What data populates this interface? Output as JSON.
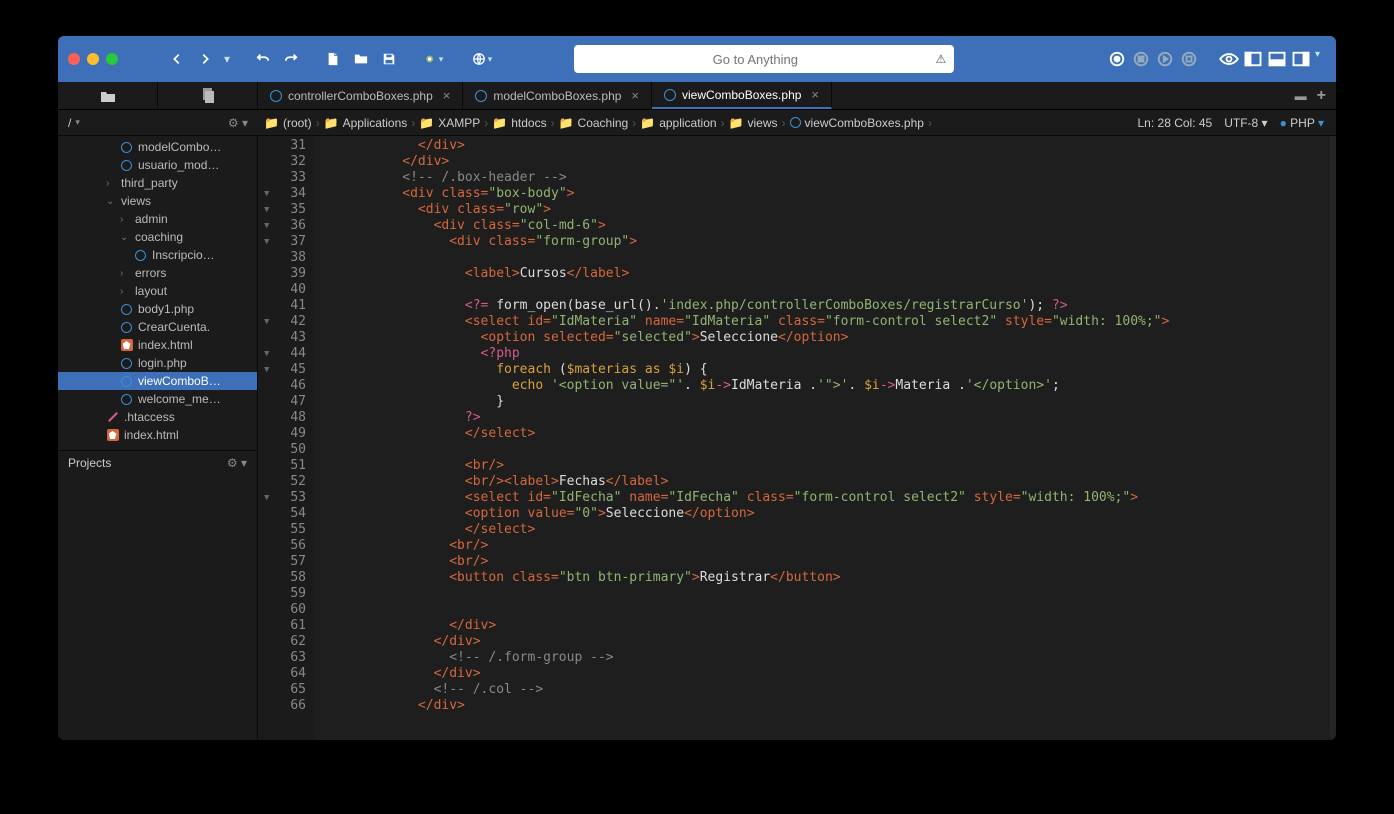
{
  "search": {
    "placeholder": "Go to Anything"
  },
  "tabs": [
    {
      "label": "controllerComboBoxes.php"
    },
    {
      "label": "modelComboBoxes.php"
    },
    {
      "label": "viewComboBoxes.php",
      "active": true
    }
  ],
  "sidebarRoot": "/",
  "breadcrumbs": [
    "(root)",
    "Applications",
    "XAMPP",
    "htdocs",
    "Coaching",
    "application",
    "views",
    "viewComboBoxes.php"
  ],
  "status": {
    "pos": "Ln: 28 Col: 45",
    "enc": "UTF-8",
    "lang": "PHP"
  },
  "tree": [
    {
      "d": 3,
      "ic": "ring",
      "label": "modelCombo…"
    },
    {
      "d": 3,
      "ic": "ring",
      "label": "usuario_mod…"
    },
    {
      "d": 2,
      "exp": "›",
      "label": "third_party"
    },
    {
      "d": 2,
      "exp": "⌄",
      "label": "views"
    },
    {
      "d": 3,
      "exp": "›",
      "label": "admin"
    },
    {
      "d": 3,
      "exp": "⌄",
      "label": "coaching"
    },
    {
      "d": 4,
      "ic": "ring",
      "label": "Inscripcio…"
    },
    {
      "d": 3,
      "exp": "›",
      "label": "errors"
    },
    {
      "d": 3,
      "exp": "›",
      "label": "layout"
    },
    {
      "d": 3,
      "ic": "ring",
      "label": "body1.php"
    },
    {
      "d": 3,
      "ic": "ring",
      "label": "CrearCuenta."
    },
    {
      "d": 3,
      "ic": "html",
      "label": "index.html"
    },
    {
      "d": 3,
      "ic": "ring",
      "label": "login.php"
    },
    {
      "d": 3,
      "ic": "ring",
      "label": "viewComboB…",
      "sel": true
    },
    {
      "d": 3,
      "ic": "ring",
      "label": "welcome_me…"
    },
    {
      "d": 2,
      "ic": "pen",
      "label": ".htaccess"
    },
    {
      "d": 2,
      "ic": "html",
      "label": "index.html"
    }
  ],
  "projectsLabel": "Projects",
  "gutter": {
    "start": 31,
    "end": 66,
    "folds": [
      34,
      35,
      36,
      37,
      42,
      44,
      45,
      53
    ]
  },
  "code": [
    {
      "n": 31,
      "i": 6,
      "h": "<span class='t-tag'>&lt;/div&gt;</span>"
    },
    {
      "n": 32,
      "i": 5,
      "h": "<span class='t-tag'>&lt;/div&gt;</span>"
    },
    {
      "n": 33,
      "i": 5,
      "h": "<span class='t-cm'>&lt;!-- /.box-header --&gt;</span>"
    },
    {
      "n": 34,
      "i": 5,
      "h": "<span class='t-tag'>&lt;div</span> <span class='t-attr'>class=</span><span class='t-str'>\"box-body\"</span><span class='t-tag'>&gt;</span>"
    },
    {
      "n": 35,
      "i": 6,
      "h": "<span class='t-tag'>&lt;div</span> <span class='t-attr'>class=</span><span class='t-str'>\"row\"</span><span class='t-tag'>&gt;</span>"
    },
    {
      "n": 36,
      "i": 7,
      "h": "<span class='t-tag'>&lt;div</span> <span class='t-attr'>class=</span><span class='t-str'>\"col-md-6\"</span><span class='t-tag'>&gt;</span>"
    },
    {
      "n": 37,
      "i": 8,
      "h": "<span class='t-tag'>&lt;div</span> <span class='t-attr'>class=</span><span class='t-str'>\"form-group\"</span><span class='t-tag'>&gt;</span>"
    },
    {
      "n": 38,
      "i": 0,
      "h": ""
    },
    {
      "n": 39,
      "i": 9,
      "h": "<span class='t-tag'>&lt;label&gt;</span><span class='t-txt'>Cursos</span><span class='t-tag'>&lt;/label&gt;</span>"
    },
    {
      "n": 40,
      "i": 0,
      "h": ""
    },
    {
      "n": 41,
      "i": 9,
      "h": "<span class='t-php'>&lt;?=</span> <span class='t-txt'>form_open(base_url().</span><span class='t-str'>'index.php/controllerComboBoxes/registrarCurso'</span><span class='t-txt'>); </span><span class='t-php'>?&gt;</span>"
    },
    {
      "n": 42,
      "i": 9,
      "h": "<span class='t-tag'>&lt;select</span> <span class='t-attr'>id=</span><span class='t-str'>\"IdMateria\"</span> <span class='t-attr'>name=</span><span class='t-str'>\"IdMateria\"</span> <span class='t-attr'>class=</span><span class='t-str'>\"form-control select2\"</span> <span class='t-attr'>style=</span><span class='t-str'>\"width: 100%;\"</span><span class='t-tag'>&gt;</span>"
    },
    {
      "n": 43,
      "i": 10,
      "h": "<span class='t-tag'>&lt;option</span> <span class='t-attr'>selected=</span><span class='t-str'>\"selected\"</span><span class='t-tag'>&gt;</span><span class='t-txt'>Seleccione</span><span class='t-tag'>&lt;/option&gt;</span>"
    },
    {
      "n": 44,
      "i": 10,
      "h": "<span class='t-php'>&lt;?php</span>"
    },
    {
      "n": 45,
      "i": 11,
      "h": "<span class='t-kw'>foreach</span> <span class='t-txt'>(</span><span class='t-var'>$materias</span> <span class='t-kw'>as</span> <span class='t-var'>$i</span><span class='t-txt'>) {</span>"
    },
    {
      "n": 46,
      "i": 12,
      "h": "<span class='t-kw'>echo</span> <span class='t-str'>'&lt;option value=\"'</span><span class='t-txt'>. </span><span class='t-var'>$i</span><span class='t-op'>-&gt;</span><span class='t-txt'>IdMateria .</span><span class='t-str'>'\"&gt;'</span><span class='t-txt'>. </span><span class='t-var'>$i</span><span class='t-op'>-&gt;</span><span class='t-txt'>Materia .</span><span class='t-str'>'&lt;/option&gt;'</span><span class='t-txt'>;</span>"
    },
    {
      "n": 47,
      "i": 11,
      "h": "<span class='t-txt'>}</span>"
    },
    {
      "n": 48,
      "i": 9,
      "h": "<span class='t-php'>?&gt;</span>"
    },
    {
      "n": 49,
      "i": 9,
      "h": "<span class='t-tag'>&lt;/select&gt;</span>"
    },
    {
      "n": 50,
      "i": 0,
      "h": ""
    },
    {
      "n": 51,
      "i": 9,
      "h": "<span class='t-tag'>&lt;br/&gt;</span>"
    },
    {
      "n": 52,
      "i": 9,
      "h": "<span class='t-tag'>&lt;br/&gt;&lt;label&gt;</span><span class='t-txt'>Fechas</span><span class='t-tag'>&lt;/label&gt;</span>"
    },
    {
      "n": 53,
      "i": 9,
      "h": "<span class='t-tag'>&lt;select</span> <span class='t-attr'>id=</span><span class='t-str'>\"IdFecha\"</span> <span class='t-attr'>name=</span><span class='t-str'>\"IdFecha\"</span> <span class='t-attr'>class=</span><span class='t-str'>\"form-control select2\"</span> <span class='t-attr'>style=</span><span class='t-str'>\"width: 100%;\"</span><span class='t-tag'>&gt;</span>"
    },
    {
      "n": 54,
      "i": 9,
      "h": "<span class='t-tag'>&lt;option</span> <span class='t-attr'>value=</span><span class='t-str'>\"0\"</span><span class='t-tag'>&gt;</span><span class='t-txt'>Seleccione</span><span class='t-tag'>&lt;/option&gt;</span>"
    },
    {
      "n": 55,
      "i": 9,
      "h": "<span class='t-tag'>&lt;/select&gt;</span>"
    },
    {
      "n": 56,
      "i": 8,
      "h": "<span class='t-tag'>&lt;br/&gt;</span>"
    },
    {
      "n": 57,
      "i": 8,
      "h": "<span class='t-tag'>&lt;br/&gt;</span>"
    },
    {
      "n": 58,
      "i": 8,
      "h": "<span class='t-tag'>&lt;button</span> <span class='t-attr'>class=</span><span class='t-str'>\"btn btn-primary\"</span><span class='t-tag'>&gt;</span><span class='t-txt'>Registrar</span><span class='t-tag'>&lt;/button&gt;</span>"
    },
    {
      "n": 59,
      "i": 0,
      "h": ""
    },
    {
      "n": 60,
      "i": 0,
      "h": ""
    },
    {
      "n": 61,
      "i": 8,
      "h": "<span class='t-tag'>&lt;/div&gt;</span>"
    },
    {
      "n": 62,
      "i": 7,
      "h": "<span class='t-tag'>&lt;/div&gt;</span>"
    },
    {
      "n": 63,
      "i": 8,
      "h": "<span class='t-cm'>&lt;!-- /.form-group --&gt;</span>"
    },
    {
      "n": 64,
      "i": 7,
      "h": "<span class='t-tag'>&lt;/div&gt;</span>"
    },
    {
      "n": 65,
      "i": 7,
      "h": "<span class='t-cm'>&lt;!-- /.col --&gt;</span>"
    },
    {
      "n": 66,
      "i": 6,
      "h": "<span class='t-tag'>&lt;/div&gt;</span>"
    }
  ]
}
